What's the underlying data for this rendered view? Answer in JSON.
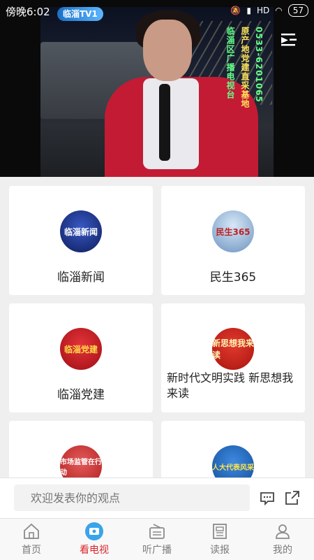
{
  "status_bar": {
    "time": "傍晚6:02",
    "network": "HD",
    "battery": "57"
  },
  "video": {
    "station_logo": "临淄TV1",
    "caption_col1": "临淄区广播电视台",
    "caption_col2": "原产地党建直采基地",
    "caption_col3": "0533-6201065"
  },
  "cards": [
    {
      "label": "临淄新闻",
      "logo_text": "临淄新闻",
      "logo_color": "#1f3b9a"
    },
    {
      "label": "民生365",
      "logo_text": "民生365",
      "logo_color": "#8fb7df"
    },
    {
      "label": "临淄党建",
      "logo_text": "临淄党建",
      "logo_color": "#c8161d"
    },
    {
      "label": "新时代文明实践 新思想我来读",
      "logo_text": "新思想我来读",
      "logo_color": "#c8161d"
    },
    {
      "label": "",
      "logo_text": "市场监管在行动",
      "logo_color": "#d43b3b"
    },
    {
      "label": "",
      "logo_text": "人大代表风采",
      "logo_color": "#1d6dc4"
    }
  ],
  "comment": {
    "placeholder": "欢迎发表你的观点"
  },
  "tabs": [
    {
      "label": "首页"
    },
    {
      "label": "看电视"
    },
    {
      "label": "听广播"
    },
    {
      "label": "读报"
    },
    {
      "label": "我的"
    }
  ],
  "colors": {
    "accent": "#d9262c",
    "inactive": "#7a7a7a"
  }
}
